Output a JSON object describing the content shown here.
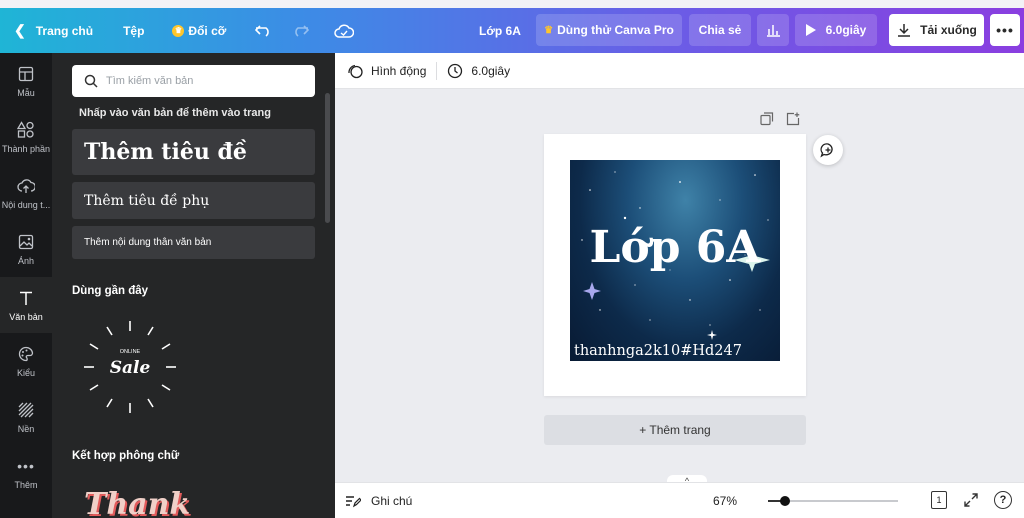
{
  "topbar": {
    "home_label": "Trang chủ",
    "file_label": "Tệp",
    "resize_label": "Đổi cỡ",
    "title": "Lớp 6A",
    "try_pro_label": "Dùng thử Canva Pro",
    "share_label": "Chia sẻ",
    "present_label": "6.0giây",
    "download_label": "Tải xuống",
    "more_label": "•••"
  },
  "rail": {
    "items": [
      {
        "label": "Mẫu",
        "icon": "template-icon"
      },
      {
        "label": "Thành phần",
        "icon": "elements-icon"
      },
      {
        "label": "Nội dung t...",
        "icon": "upload-icon"
      },
      {
        "label": "Ảnh",
        "icon": "photo-icon"
      },
      {
        "label": "Văn bản",
        "icon": "text-icon"
      },
      {
        "label": "Kiểu",
        "icon": "palette-icon"
      },
      {
        "label": "Nền",
        "icon": "background-icon"
      },
      {
        "label": "Thêm",
        "icon": "more-icon"
      }
    ]
  },
  "panel": {
    "search_placeholder": "Tìm kiếm văn bản",
    "hint": "Nhấp vào văn bản để thêm vào trang",
    "add_heading": "Thêm tiêu đề",
    "add_subheading": "Thêm tiêu đề phụ",
    "add_body": "Thêm nội dung thân văn bản",
    "recent_title": "Dùng gần đây",
    "combo_title": "Kết hợp phông chữ",
    "sale_small": "ONLINE",
    "sale_big": "Sale",
    "thanks_text": "Thank"
  },
  "canvas_toolbar": {
    "animate_label": "Hình động",
    "duration_label": "6.0giây"
  },
  "design": {
    "title": "Lớp 6A",
    "subtitle": "thanhnga2k10#Hd247"
  },
  "workspace": {
    "add_page_label": "+ Thêm trang",
    "notes_toggle": "^"
  },
  "bottombar": {
    "notes_label": "Ghi chú",
    "zoom_label": "67%",
    "zoom_fraction": 0.13,
    "page_count": "1",
    "help_label": "?"
  }
}
